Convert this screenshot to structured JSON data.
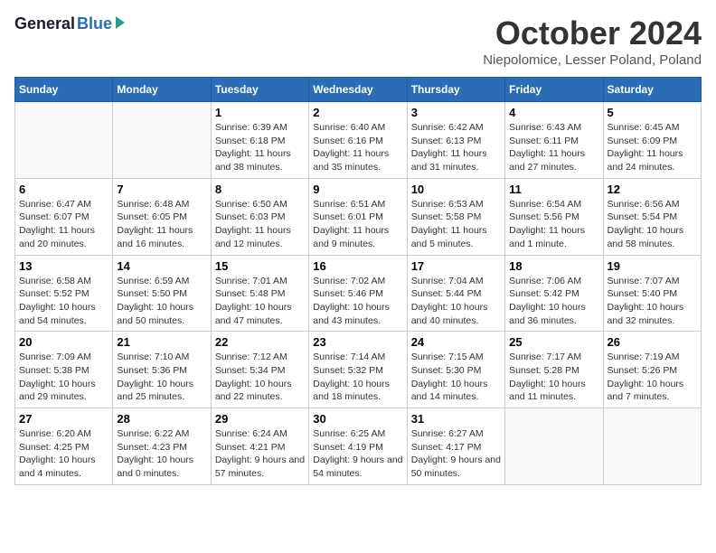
{
  "header": {
    "logo_general": "General",
    "logo_blue": "Blue",
    "month_title": "October 2024",
    "location": "Niepolomice, Lesser Poland, Poland"
  },
  "days_of_week": [
    "Sunday",
    "Monday",
    "Tuesday",
    "Wednesday",
    "Thursday",
    "Friday",
    "Saturday"
  ],
  "weeks": [
    [
      {
        "day": "",
        "info": ""
      },
      {
        "day": "",
        "info": ""
      },
      {
        "day": "1",
        "info": "Sunrise: 6:39 AM\nSunset: 6:18 PM\nDaylight: 11 hours and 38 minutes."
      },
      {
        "day": "2",
        "info": "Sunrise: 6:40 AM\nSunset: 6:16 PM\nDaylight: 11 hours and 35 minutes."
      },
      {
        "day": "3",
        "info": "Sunrise: 6:42 AM\nSunset: 6:13 PM\nDaylight: 11 hours and 31 minutes."
      },
      {
        "day": "4",
        "info": "Sunrise: 6:43 AM\nSunset: 6:11 PM\nDaylight: 11 hours and 27 minutes."
      },
      {
        "day": "5",
        "info": "Sunrise: 6:45 AM\nSunset: 6:09 PM\nDaylight: 11 hours and 24 minutes."
      }
    ],
    [
      {
        "day": "6",
        "info": "Sunrise: 6:47 AM\nSunset: 6:07 PM\nDaylight: 11 hours and 20 minutes."
      },
      {
        "day": "7",
        "info": "Sunrise: 6:48 AM\nSunset: 6:05 PM\nDaylight: 11 hours and 16 minutes."
      },
      {
        "day": "8",
        "info": "Sunrise: 6:50 AM\nSunset: 6:03 PM\nDaylight: 11 hours and 12 minutes."
      },
      {
        "day": "9",
        "info": "Sunrise: 6:51 AM\nSunset: 6:01 PM\nDaylight: 11 hours and 9 minutes."
      },
      {
        "day": "10",
        "info": "Sunrise: 6:53 AM\nSunset: 5:58 PM\nDaylight: 11 hours and 5 minutes."
      },
      {
        "day": "11",
        "info": "Sunrise: 6:54 AM\nSunset: 5:56 PM\nDaylight: 11 hours and 1 minute."
      },
      {
        "day": "12",
        "info": "Sunrise: 6:56 AM\nSunset: 5:54 PM\nDaylight: 10 hours and 58 minutes."
      }
    ],
    [
      {
        "day": "13",
        "info": "Sunrise: 6:58 AM\nSunset: 5:52 PM\nDaylight: 10 hours and 54 minutes."
      },
      {
        "day": "14",
        "info": "Sunrise: 6:59 AM\nSunset: 5:50 PM\nDaylight: 10 hours and 50 minutes."
      },
      {
        "day": "15",
        "info": "Sunrise: 7:01 AM\nSunset: 5:48 PM\nDaylight: 10 hours and 47 minutes."
      },
      {
        "day": "16",
        "info": "Sunrise: 7:02 AM\nSunset: 5:46 PM\nDaylight: 10 hours and 43 minutes."
      },
      {
        "day": "17",
        "info": "Sunrise: 7:04 AM\nSunset: 5:44 PM\nDaylight: 10 hours and 40 minutes."
      },
      {
        "day": "18",
        "info": "Sunrise: 7:06 AM\nSunset: 5:42 PM\nDaylight: 10 hours and 36 minutes."
      },
      {
        "day": "19",
        "info": "Sunrise: 7:07 AM\nSunset: 5:40 PM\nDaylight: 10 hours and 32 minutes."
      }
    ],
    [
      {
        "day": "20",
        "info": "Sunrise: 7:09 AM\nSunset: 5:38 PM\nDaylight: 10 hours and 29 minutes."
      },
      {
        "day": "21",
        "info": "Sunrise: 7:10 AM\nSunset: 5:36 PM\nDaylight: 10 hours and 25 minutes."
      },
      {
        "day": "22",
        "info": "Sunrise: 7:12 AM\nSunset: 5:34 PM\nDaylight: 10 hours and 22 minutes."
      },
      {
        "day": "23",
        "info": "Sunrise: 7:14 AM\nSunset: 5:32 PM\nDaylight: 10 hours and 18 minutes."
      },
      {
        "day": "24",
        "info": "Sunrise: 7:15 AM\nSunset: 5:30 PM\nDaylight: 10 hours and 14 minutes."
      },
      {
        "day": "25",
        "info": "Sunrise: 7:17 AM\nSunset: 5:28 PM\nDaylight: 10 hours and 11 minutes."
      },
      {
        "day": "26",
        "info": "Sunrise: 7:19 AM\nSunset: 5:26 PM\nDaylight: 10 hours and 7 minutes."
      }
    ],
    [
      {
        "day": "27",
        "info": "Sunrise: 6:20 AM\nSunset: 4:25 PM\nDaylight: 10 hours and 4 minutes."
      },
      {
        "day": "28",
        "info": "Sunrise: 6:22 AM\nSunset: 4:23 PM\nDaylight: 10 hours and 0 minutes."
      },
      {
        "day": "29",
        "info": "Sunrise: 6:24 AM\nSunset: 4:21 PM\nDaylight: 9 hours and 57 minutes."
      },
      {
        "day": "30",
        "info": "Sunrise: 6:25 AM\nSunset: 4:19 PM\nDaylight: 9 hours and 54 minutes."
      },
      {
        "day": "31",
        "info": "Sunrise: 6:27 AM\nSunset: 4:17 PM\nDaylight: 9 hours and 50 minutes."
      },
      {
        "day": "",
        "info": ""
      },
      {
        "day": "",
        "info": ""
      }
    ]
  ]
}
